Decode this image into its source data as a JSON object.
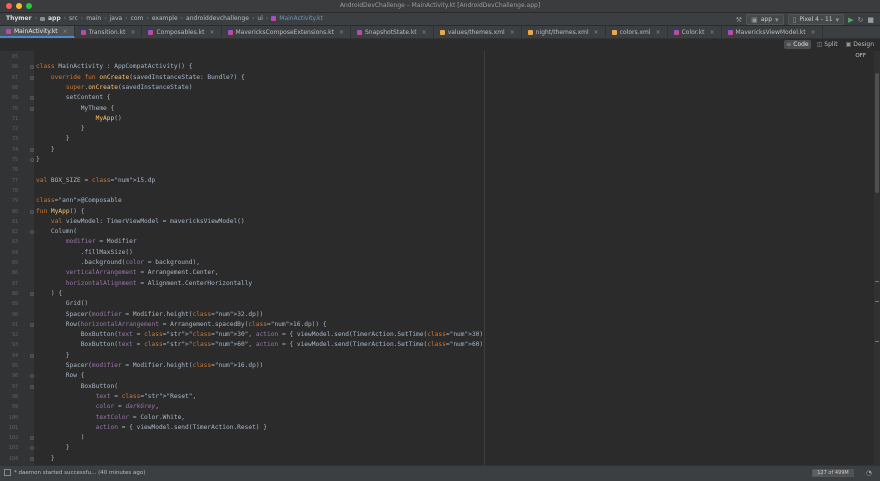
{
  "window": {
    "title": "AndroidDevChallenge – MainActivity.kt [AndroidDevChallenge.app]"
  },
  "breadcrumbs": [
    "Thymer",
    "app",
    "src",
    "main",
    "java",
    "com",
    "example",
    "androiddevchallenge",
    "ui",
    "MainActivity.kt"
  ],
  "toolbar": {
    "config": "app",
    "device": "Pixel 4 - 11",
    "run_icon": "run-icon",
    "debug_icon": "rerun-icon",
    "stop_icon": "stop-icon"
  },
  "tabs": [
    {
      "label": "MainActivity.kt",
      "kind": "kt",
      "active": true
    },
    {
      "label": "Transition.kt",
      "kind": "kt"
    },
    {
      "label": "Composables.kt",
      "kind": "kt"
    },
    {
      "label": "MavericksComposeExtensions.kt",
      "kind": "kt"
    },
    {
      "label": "SnapshotState.kt",
      "kind": "kt"
    },
    {
      "label": "values/themes.xml",
      "kind": "xml"
    },
    {
      "label": "night/themes.xml",
      "kind": "xml"
    },
    {
      "label": "colors.xml",
      "kind": "xml"
    },
    {
      "label": "Color.kt",
      "kind": "kt"
    },
    {
      "label": "MavericksViewModel.kt",
      "kind": "kt"
    }
  ],
  "view_modes": [
    {
      "label": "Code",
      "active": true
    },
    {
      "label": "Split"
    },
    {
      "label": "Design"
    }
  ],
  "preview": {
    "label": "OFF"
  },
  "editor": {
    "line_numbers": [
      "65",
      "66",
      "67",
      "68",
      "69",
      "70",
      "71",
      "72",
      "73",
      "74",
      "75",
      "76",
      "77",
      "78",
      "79",
      "80",
      "81",
      "82",
      "83",
      "84",
      "85",
      "86",
      "87",
      "88",
      "89",
      "90",
      "91",
      "92",
      "93",
      "94",
      "95",
      "96",
      "97",
      "98",
      "99",
      "100",
      "101",
      "102",
      "103",
      "104"
    ],
    "lines": [
      "",
      "class MainActivity : AppCompatActivity() {",
      "    override fun onCreate(savedInstanceState: Bundle?) {",
      "        super.onCreate(savedInstanceState)",
      "        setContent {",
      "            MyTheme {",
      "                MyApp()",
      "            }",
      "        }",
      "    }",
      "}",
      "",
      "val BOX_SIZE = 15.dp",
      "",
      "@Composable",
      "fun MyApp() {",
      "    val viewModel: TimerViewModel = mavericksViewModel()",
      "    Column(",
      "        modifier = Modifier",
      "            .fillMaxSize()",
      "            .background(color = background),",
      "        verticalArrangement = Arrangement.Center,",
      "        horizontalAlignment = Alignment.CenterHorizontally",
      "    ) {",
      "        Grid()",
      "        Spacer(modifier = Modifier.height(32.dp))",
      "        Row(horizontalArrangement = Arrangement.spacedBy(16.dp)) {",
      "            BoxButton(text = \"30\", action = { viewModel.send(TimerAction.SetTime(30)) })",
      "            BoxButton(text = \"60\", action = { viewModel.send(TimerAction.SetTime(60)) })",
      "        }",
      "        Spacer(modifier = Modifier.height(16.dp))",
      "        Row {",
      "            BoxButton(",
      "                text = \"Reset\",",
      "                color = darkGrey,",
      "                textColor = Color.White,",
      "                action = { viewModel.send(TimerAction.Reset) }",
      "            )",
      "        }",
      "    }"
    ]
  },
  "statusbar": {
    "message": "* daemon started successfu... (40 minutes ago)",
    "memory_used": "127",
    "memory_total": "of 499M",
    "memory_fraction": 0.25
  },
  "colors": {
    "keyword": "#cc7832",
    "function": "#ffc66d",
    "string": "#6a8759",
    "number": "#6897bb",
    "parameter": "#9876aa",
    "annotation": "#bbb529",
    "accent": "#4a88c7"
  }
}
